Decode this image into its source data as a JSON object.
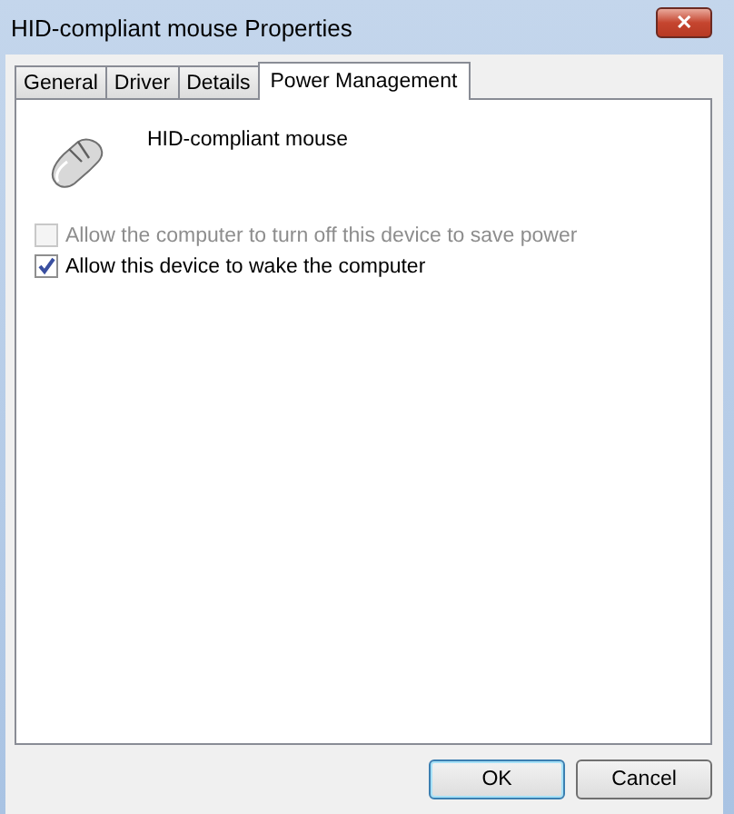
{
  "window": {
    "title": "HID-compliant mouse Properties",
    "close_label": "✕"
  },
  "tabs": [
    {
      "label": "General",
      "selected": false
    },
    {
      "label": "Driver",
      "selected": false
    },
    {
      "label": "Details",
      "selected": false
    },
    {
      "label": "Power Management",
      "selected": true
    }
  ],
  "device": {
    "name": "HID-compliant mouse"
  },
  "options": [
    {
      "label": "Allow the computer to turn off this device to save power",
      "checked": false,
      "disabled": true
    },
    {
      "label": "Allow this device to wake the computer",
      "checked": true,
      "disabled": false
    }
  ],
  "buttons": [
    {
      "label": "OK",
      "default": true
    },
    {
      "label": "Cancel",
      "default": false
    }
  ]
}
